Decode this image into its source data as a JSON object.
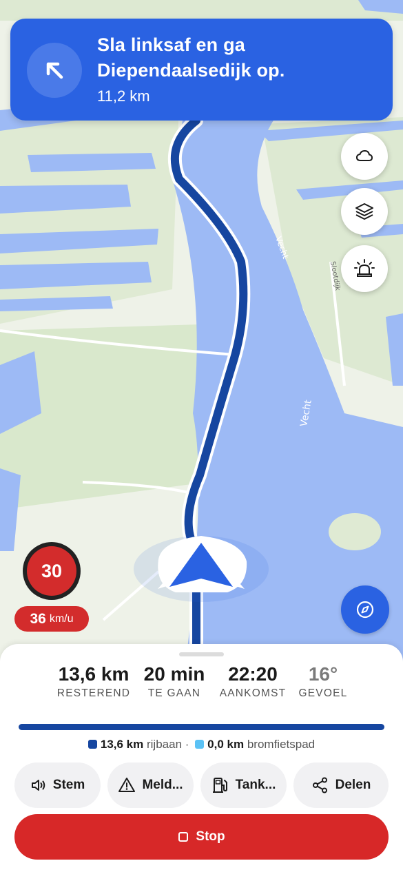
{
  "colors": {
    "accent": "#2a62e2",
    "route": "#1646a0",
    "danger": "#d72828",
    "water": "#9dbaf5",
    "land": "#eef2e8"
  },
  "banner": {
    "icon": "arrow-up-left-icon",
    "instruction": "Sla linksaf en ga Diependaalsedijk op.",
    "distance": "11,2 km"
  },
  "map_buttons": [
    "weather-cloud-icon",
    "layers-icon",
    "siren-alert-icon"
  ],
  "map_labels": {
    "river_upper": "Vecht",
    "river_lower": "Vecht",
    "road": "Slootdijk"
  },
  "speed_limit": "30",
  "current_speed": {
    "value": "36",
    "unit": "km/u"
  },
  "compass": "compass-icon",
  "stats": [
    {
      "value": "13,6 km",
      "label": "RESTEREND"
    },
    {
      "value": "20 min",
      "label": "TE GAAN"
    },
    {
      "value": "22:20",
      "label": "AANKOMST"
    },
    {
      "value": "16°",
      "label": "GEVOEL"
    }
  ],
  "progress": 1.0,
  "legend": {
    "road": {
      "value": "13,6 km",
      "label": "rijbaan",
      "color": "#1646a0"
    },
    "separator": "·",
    "bike": {
      "value": "0,0 km",
      "label": "bromfietspad",
      "color": "#5bc2f5"
    }
  },
  "actions": [
    {
      "label": "Stem",
      "icon": "speaker-icon"
    },
    {
      "label": "Meld...",
      "icon": "warning-icon"
    },
    {
      "label": "Tank...",
      "icon": "fuel-pump-icon"
    },
    {
      "label": "Delen",
      "icon": "share-icon"
    }
  ],
  "stop": {
    "label": "Stop",
    "icon": "stop-square-icon"
  }
}
